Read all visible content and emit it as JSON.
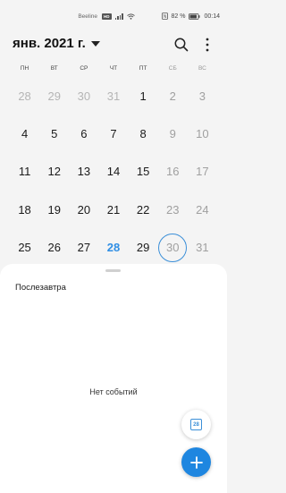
{
  "status_bar": {
    "carrier": "Beeline",
    "network_badge": "HD",
    "battery": "82 %",
    "time": "00:14"
  },
  "header": {
    "month_title": "янв. 2021 г."
  },
  "weekdays": [
    {
      "label": "ПН",
      "weekend": false
    },
    {
      "label": "ВТ",
      "weekend": false
    },
    {
      "label": "СР",
      "weekend": false
    },
    {
      "label": "ЧТ",
      "weekend": false
    },
    {
      "label": "ПТ",
      "weekend": false
    },
    {
      "label": "СБ",
      "weekend": true
    },
    {
      "label": "ВС",
      "weekend": true
    }
  ],
  "calendar_weeks": [
    [
      {
        "day": "28",
        "state": "other"
      },
      {
        "day": "29",
        "state": "other"
      },
      {
        "day": "30",
        "state": "other"
      },
      {
        "day": "31",
        "state": "other"
      },
      {
        "day": "1",
        "state": ""
      },
      {
        "day": "2",
        "state": "weekend"
      },
      {
        "day": "3",
        "state": "weekend"
      }
    ],
    [
      {
        "day": "4",
        "state": ""
      },
      {
        "day": "5",
        "state": ""
      },
      {
        "day": "6",
        "state": ""
      },
      {
        "day": "7",
        "state": ""
      },
      {
        "day": "8",
        "state": ""
      },
      {
        "day": "9",
        "state": "weekend"
      },
      {
        "day": "10",
        "state": "weekend"
      }
    ],
    [
      {
        "day": "11",
        "state": ""
      },
      {
        "day": "12",
        "state": ""
      },
      {
        "day": "13",
        "state": ""
      },
      {
        "day": "14",
        "state": ""
      },
      {
        "day": "15",
        "state": ""
      },
      {
        "day": "16",
        "state": "weekend"
      },
      {
        "day": "17",
        "state": "weekend"
      }
    ],
    [
      {
        "day": "18",
        "state": ""
      },
      {
        "day": "19",
        "state": ""
      },
      {
        "day": "20",
        "state": ""
      },
      {
        "day": "21",
        "state": ""
      },
      {
        "day": "22",
        "state": ""
      },
      {
        "day": "23",
        "state": "weekend"
      },
      {
        "day": "24",
        "state": "weekend"
      }
    ],
    [
      {
        "day": "25",
        "state": ""
      },
      {
        "day": "26",
        "state": ""
      },
      {
        "day": "27",
        "state": ""
      },
      {
        "day": "28",
        "state": "today"
      },
      {
        "day": "29",
        "state": ""
      },
      {
        "day": "30",
        "state": "weekend selected"
      },
      {
        "day": "31",
        "state": "weekend"
      }
    ]
  ],
  "sheet": {
    "day_label": "Послезавтра",
    "empty_text": "Нет событий"
  },
  "today_button": {
    "day_number": "28"
  },
  "colors": {
    "accent": "#1e86e0",
    "today_text": "#2f8ee4",
    "selected_ring": "#3b8fd8",
    "muted": "#b5b5b5"
  }
}
